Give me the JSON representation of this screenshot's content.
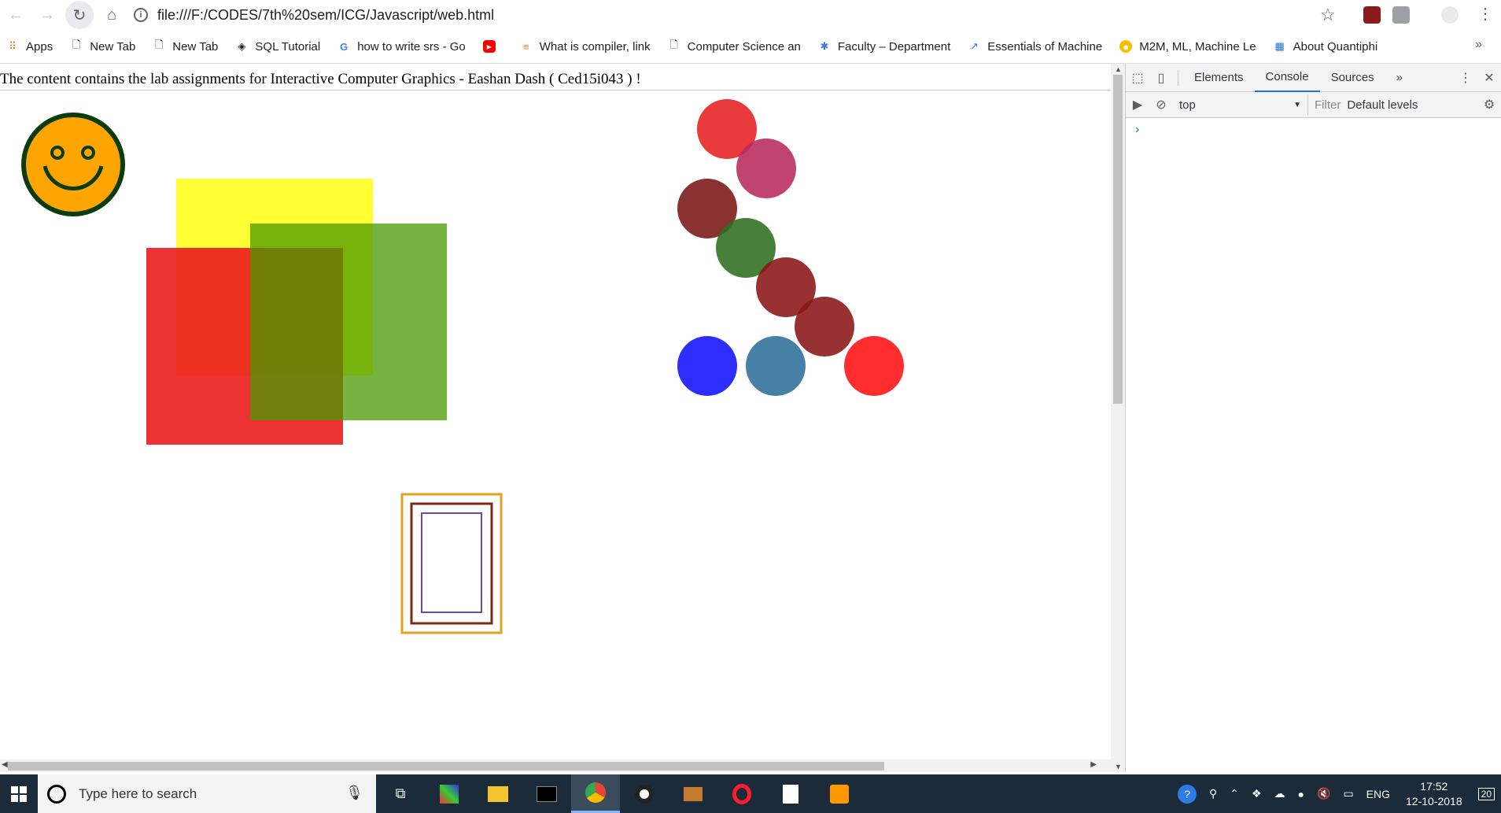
{
  "browser": {
    "url": "file:///F:/CODES/7th%20sem/ICG/Javascript/web.html",
    "bookmarks": [
      {
        "label": "Apps",
        "icon": "apps-grid-icon"
      },
      {
        "label": "New Tab",
        "icon": "page-icon"
      },
      {
        "label": "New Tab",
        "icon": "page-icon"
      },
      {
        "label": "SQL Tutorial",
        "icon": "diamond-icon"
      },
      {
        "label": "how to write srs - Go",
        "icon": "google-icon"
      },
      {
        "label": "",
        "icon": "youtube-icon"
      },
      {
        "label": "What is compiler, link",
        "icon": "stack-icon"
      },
      {
        "label": "Computer Science an",
        "icon": "page-icon"
      },
      {
        "label": "Faculty – Department",
        "icon": "dept-icon"
      },
      {
        "label": "Essentials of Machine",
        "icon": "chart-icon"
      },
      {
        "label": "M2M, ML, Machine Le",
        "icon": "bulb-icon"
      },
      {
        "label": "About Quantiphi",
        "icon": "grid-icon"
      }
    ],
    "more": "»"
  },
  "page": {
    "heading": "The content contains the lab assignments for Interactive Computer Graphics - Eashan Dash ( Ced15i043 ) !"
  },
  "canvas": {
    "smiley": {
      "face": "#ffa500",
      "stroke": "#0a3d0a"
    },
    "rects": [
      {
        "color": "#ffff00",
        "opacity": 0.8
      },
      {
        "color": "#ea1c1c",
        "opacity": 0.9
      },
      {
        "color": "#4a9a00",
        "opacity": 0.75
      }
    ],
    "circles": [
      {
        "color": "#e62020"
      },
      {
        "color": "#b82a5c"
      },
      {
        "color": "#7a1414"
      },
      {
        "color": "#2e6e1e"
      },
      {
        "color": "#8a1414"
      },
      {
        "color": "#8a1414"
      },
      {
        "color": "#1010ff"
      },
      {
        "color": "#2e6e98"
      },
      {
        "color": "#ff1010"
      }
    ],
    "frames": [
      {
        "color": "#e6a020"
      },
      {
        "color": "#7a2a10"
      },
      {
        "color": "#6a4ab0"
      }
    ]
  },
  "devtools": {
    "tabs": [
      "Elements",
      "Console",
      "Sources"
    ],
    "active_tab": "Console",
    "more": "»",
    "context": "top",
    "filter_placeholder": "Filter",
    "levels": "Default levels",
    "prompt": "›"
  },
  "taskbar": {
    "search_placeholder": "Type here to search",
    "language": "ENG",
    "time": "17:52",
    "date": "12-10-2018",
    "notifications": "20"
  }
}
